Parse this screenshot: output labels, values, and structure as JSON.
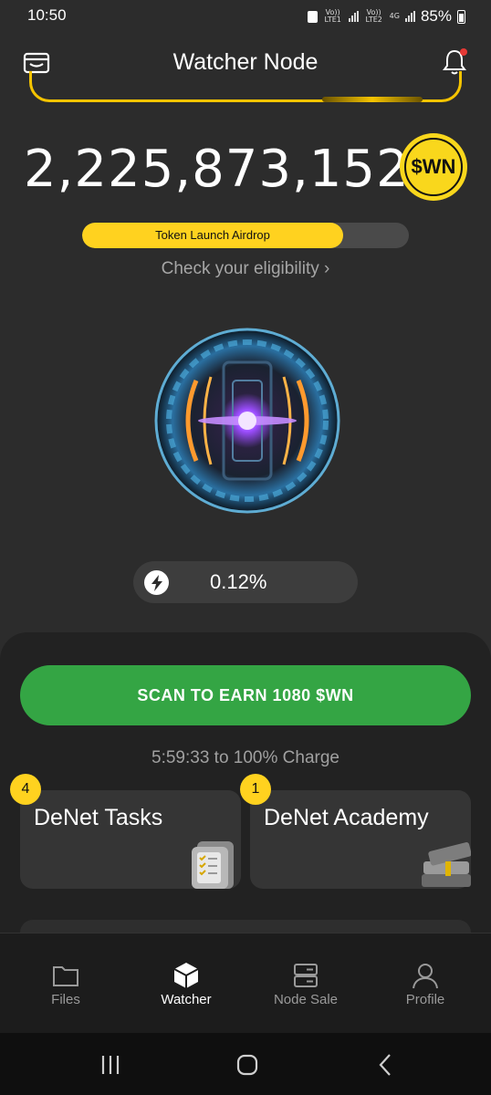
{
  "status_bar": {
    "time": "10:50",
    "battery": "85%",
    "carrier1": "Vo)) LTE1",
    "carrier2": "Vo)) LTE2",
    "network": "4G"
  },
  "header": {
    "title": "Watcher Node"
  },
  "balance": {
    "amount": "2,225,873,152",
    "token_symbol": "$WN"
  },
  "airdrop": {
    "label": "Token Launch Airdrop",
    "progress": 0.8,
    "link": "Check your eligibility ›"
  },
  "charge": {
    "value": "0.12%"
  },
  "scan": {
    "button_label": "SCAN TO EARN 1080 $WN",
    "countdown": "5:59:33 to 100% Charge"
  },
  "cards": [
    {
      "title": "DeNet Tasks",
      "badge": "4",
      "icon": "folder-checklist-icon"
    },
    {
      "title": "DeNet Academy",
      "badge": "1",
      "icon": "books-icon"
    }
  ],
  "nav": {
    "items": [
      {
        "label": "Files",
        "icon": "folder-icon"
      },
      {
        "label": "Watcher",
        "icon": "cube-icon",
        "active": true
      },
      {
        "label": "Node Sale",
        "icon": "server-icon"
      },
      {
        "label": "Profile",
        "icon": "user-icon"
      }
    ]
  },
  "colors": {
    "accent_yellow": "#ffd21f",
    "scan_green": "#34a544",
    "background": "#2c2c2c"
  }
}
